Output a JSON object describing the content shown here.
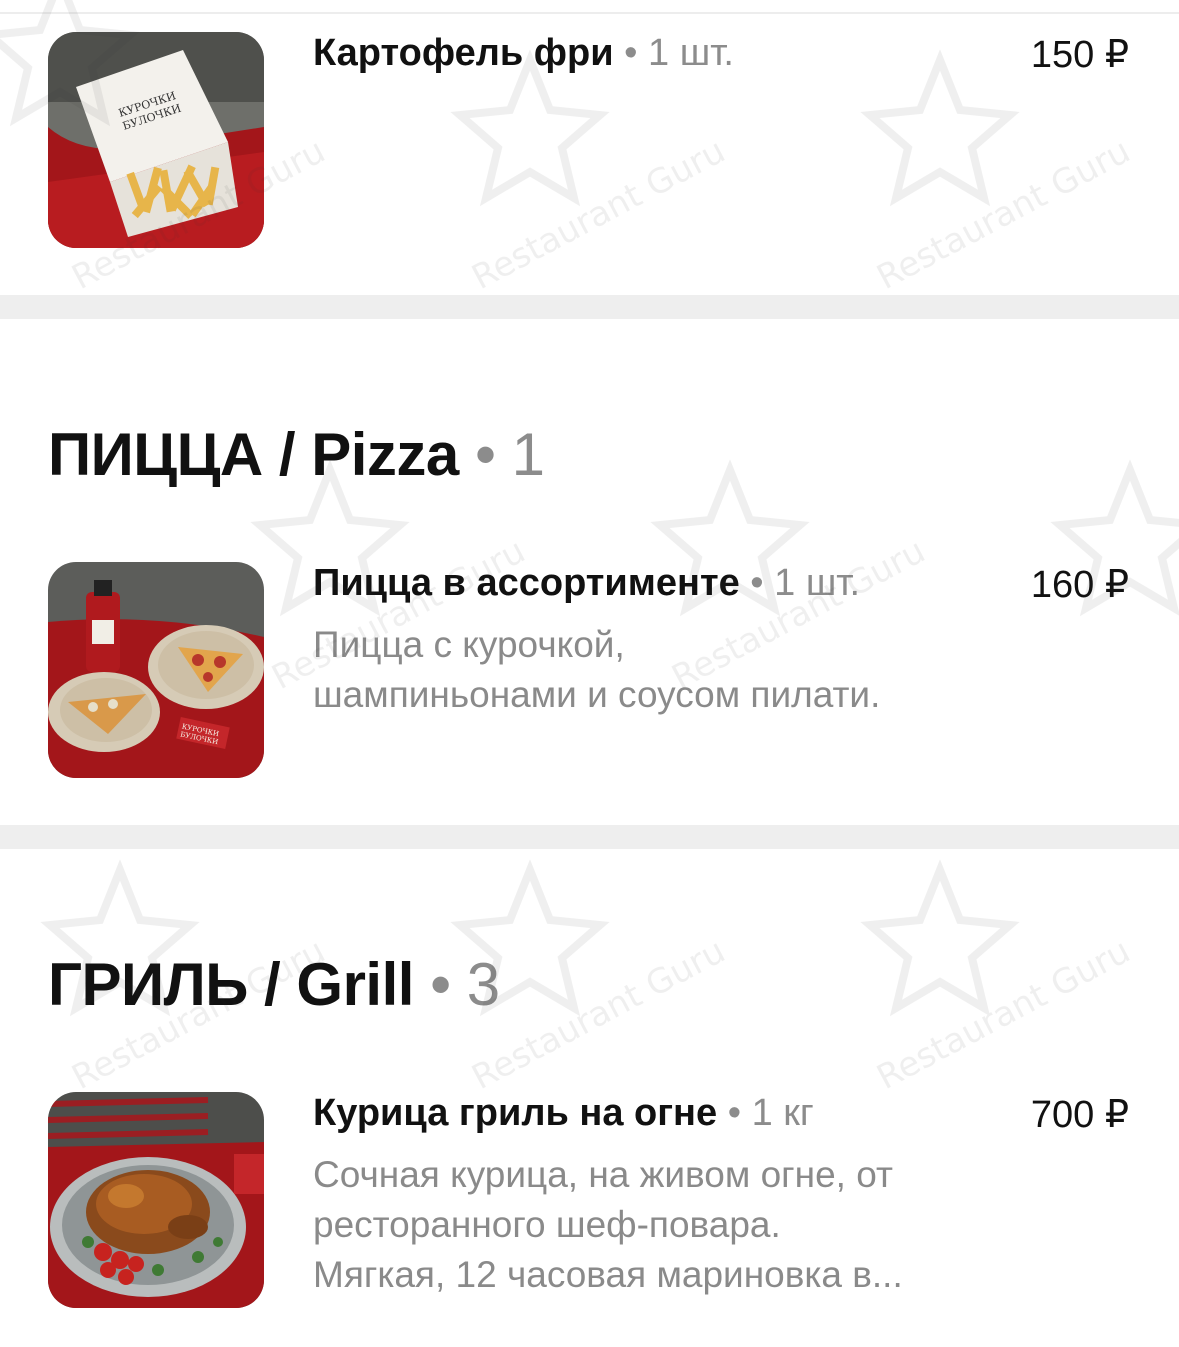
{
  "sections": [
    {
      "items": [
        {
          "name": "Картофель фри",
          "qty": "1 шт.",
          "price": "150 ₽",
          "desc": []
        }
      ]
    },
    {
      "title": "ПИЦЦА / Pizza",
      "count": "1",
      "items": [
        {
          "name": "Пицца в ассортименте",
          "qty": "1 шт.",
          "price": "160 ₽",
          "desc": [
            "Пицца с курочкой,",
            "шампиньонами и соусом пилати."
          ]
        }
      ]
    },
    {
      "title": "ГРИЛЬ / Grill",
      "count": "3",
      "items": [
        {
          "name": "Курица гриль на огне",
          "qty": "1 кг",
          "price": "700 ₽",
          "desc": [
            "Сочная курица, на живом огне, от",
            "ресторанного шеф-повара.",
            "Мягкая, 12 часовая мариновка в..."
          ]
        }
      ]
    }
  ],
  "images": {
    "fries": "Курочки Булочки",
    "pizza": "Курочки Булочки"
  },
  "watermark": "Restaurant Guru",
  "colors": {
    "accent_red": "#b0161b",
    "muted_text": "#8a8a8a",
    "divider": "#eeeeee"
  }
}
